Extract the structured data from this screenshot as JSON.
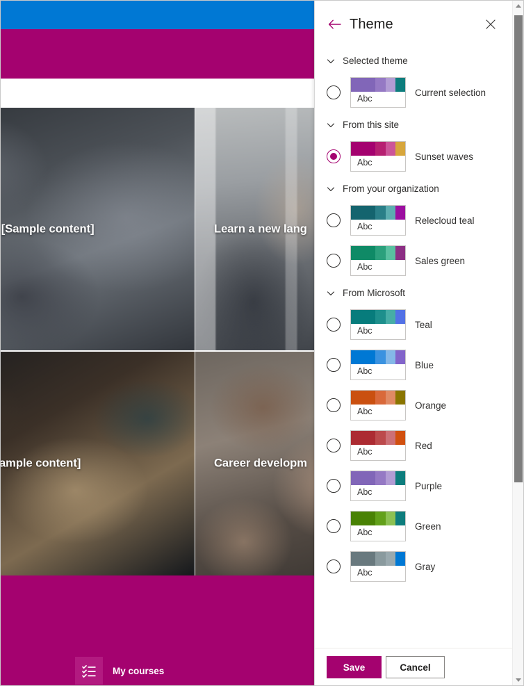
{
  "background_page": {
    "top_bar_color": "#0078d4",
    "hero_band_color": "#a4026f",
    "footer_band_color": "#a4026f",
    "cards": [
      {
        "title": "s [Sample content]",
        "photo": "handshake-photo"
      },
      {
        "title": "Learn a new lang",
        "photo": "office-meeting-photo"
      },
      {
        "title": "Sample content]",
        "photo": "woman-at-desk-photo"
      },
      {
        "title": "Career developm",
        "photo": "hands-together-photo"
      }
    ],
    "footer_link": {
      "label": "My courses",
      "icon": "checklist-icon"
    }
  },
  "panel": {
    "title": "Theme",
    "back_icon": "back-arrow-icon",
    "close_icon": "close-icon",
    "chevron_icon": "chevron-down-icon",
    "groups": [
      {
        "label": "Selected theme",
        "themes": [
          {
            "name": "Current selection",
            "selected": false,
            "sample_text": "Abc",
            "colors": [
              "#8166b8",
              "#9579c4",
              "#b29cd4",
              "#0d7d7d"
            ]
          }
        ]
      },
      {
        "label": "From this site",
        "themes": [
          {
            "name": "Sunset waves",
            "selected": true,
            "sample_text": "Abc",
            "colors": [
              "#a4026f",
              "#b62071",
              "#cc5599",
              "#d7a63c"
            ]
          }
        ]
      },
      {
        "label": "From your organization",
        "themes": [
          {
            "name": "Relecloud teal",
            "selected": false,
            "sample_text": "Abc",
            "colors": [
              "#14646e",
              "#2a7f88",
              "#5cadb0",
              "#9c0fa0"
            ]
          },
          {
            "name": "Sales green",
            "selected": false,
            "sample_text": "Abc",
            "colors": [
              "#0f8a66",
              "#2ba07c",
              "#59c0a0",
              "#8c2f84"
            ]
          }
        ]
      },
      {
        "label": "From Microsoft",
        "themes": [
          {
            "name": "Teal",
            "selected": false,
            "sample_text": "Abc",
            "colors": [
              "#077c7c",
              "#1d8f8c",
              "#46ada6",
              "#5271e6"
            ]
          },
          {
            "name": "Blue",
            "selected": false,
            "sample_text": "Abc",
            "colors": [
              "#0078d4",
              "#3a92e0",
              "#84b8e8",
              "#8264ca"
            ]
          },
          {
            "name": "Orange",
            "selected": false,
            "sample_text": "Abc",
            "colors": [
              "#ca5010",
              "#d9693a",
              "#e08a64",
              "#8a7500"
            ]
          },
          {
            "name": "Red",
            "selected": false,
            "sample_text": "Abc",
            "colors": [
              "#ac2b32",
              "#bc4a4c",
              "#cc7076",
              "#d1500f"
            ]
          },
          {
            "name": "Purple",
            "selected": false,
            "sample_text": "Abc",
            "colors": [
              "#8166b8",
              "#9579c4",
              "#b29cd4",
              "#0d7d7d"
            ]
          },
          {
            "name": "Green",
            "selected": false,
            "sample_text": "Abc",
            "colors": [
              "#498205",
              "#62a01a",
              "#8cc152",
              "#0d7d7d"
            ]
          },
          {
            "name": "Gray",
            "selected": false,
            "sample_text": "Abc",
            "colors": [
              "#69797e",
              "#8a9a9e",
              "#9aa9ae",
              "#0078d4"
            ]
          }
        ]
      }
    ],
    "footer": {
      "save_label": "Save",
      "cancel_label": "Cancel",
      "accent_color": "#a4026f"
    }
  },
  "scrollbar": {
    "up_icon": "scroll-up-arrow-icon",
    "down_icon": "scroll-down-arrow-icon"
  }
}
